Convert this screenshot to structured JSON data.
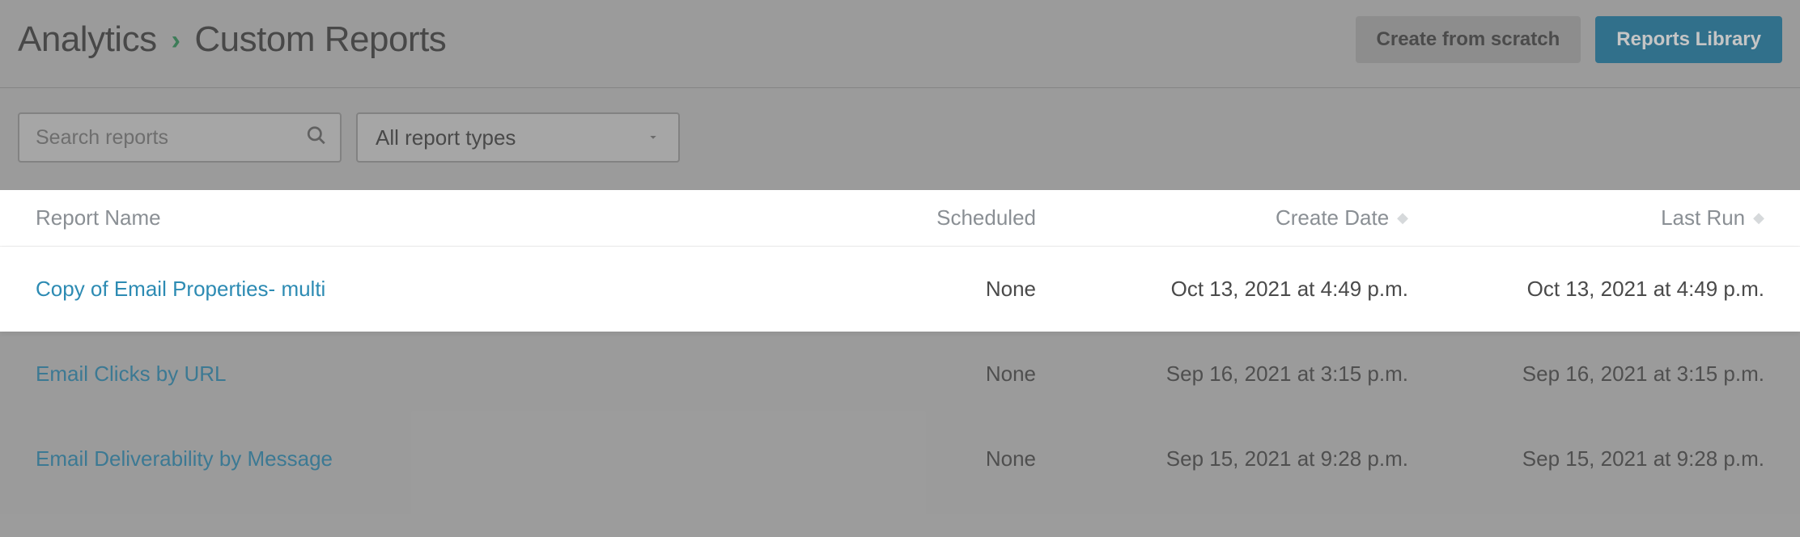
{
  "breadcrumb": {
    "root": "Analytics",
    "current": "Custom Reports"
  },
  "header": {
    "create_button": "Create from scratch",
    "library_button": "Reports Library"
  },
  "filters": {
    "search_placeholder": "Search reports",
    "type_filter_label": "All report types"
  },
  "table": {
    "columns": {
      "name": "Report Name",
      "scheduled": "Scheduled",
      "create_date": "Create Date",
      "last_run": "Last Run"
    },
    "rows": [
      {
        "name": "Copy of Email Properties- multi",
        "scheduled": "None",
        "create_date": "Oct 13, 2021 at 4:49 p.m.",
        "last_run": "Oct 13, 2021 at 4:49 p.m.",
        "highlight": true
      },
      {
        "name": "Email Clicks by URL",
        "scheduled": "None",
        "create_date": "Sep 16, 2021 at 3:15 p.m.",
        "last_run": "Sep 16, 2021 at 3:15 p.m.",
        "highlight": false
      },
      {
        "name": "Email Deliverability by Message",
        "scheduled": "None",
        "create_date": "Sep 15, 2021 at 9:28 p.m.",
        "last_run": "Sep 15, 2021 at 9:28 p.m.",
        "highlight": false
      }
    ]
  }
}
